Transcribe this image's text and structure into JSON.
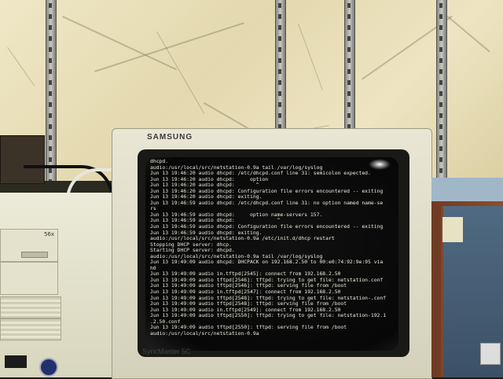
{
  "monitor": {
    "brand": "SAMSUNG",
    "model": "SyncMaster 5C"
  },
  "tower": {
    "drive_label": "56x"
  },
  "terminal": {
    "lines": [
      "dhcpd.",
      "audio:/usr/local/src/netstation-0.9a tail /var/log/syslog",
      "Jun 13 19:46:20 audio dhcpd: /etc/dhcpd.conf line 31: semicolon expected.",
      "Jun 13 19:46:20 audio dhcpd:     option",
      "Jun 13 19:46:20 audio dhcpd:       ^",
      "Jun 13 19:46:20 audio dhcpd: Configuration file errors encountered -- exiting",
      "Jun 13 19:46:20 audio dhcpd: exiting.",
      "Jun 13 19:46:59 audio dhcpd: /etc/dhcpd.conf line 31: no option named name-se",
      "rs",
      "Jun 13 19:46:59 audio dhcpd:     option name-servers 157.",
      "Jun 13 19:46:59 audio dhcpd:              ^",
      "Jun 13 19:46:59 audio dhcpd: Configuration file errors encountered -- exiting",
      "Jun 13 19:46:59 audio dhcpd: exiting.",
      "audio:/usr/local/src/netstation-0.9a /etc/init.d/dhcp restart",
      "Stopping DHCP server: dhcp.",
      "Starting DHCP server: dhcpd.",
      "audio:/usr/local/src/netstation-0.9a tail /var/log/syslog",
      "Jun 13 19:49:09 audio dhcpd: DHCPACK on 192.168.2.50 to 00:e0:74:92:9e:95 via",
      "h0",
      "Jun 13 19:49:09 audio in.tftpd[2545]: connect from 192.168.2.50",
      "Jun 13 19:49:09 audio tftpd[2546]: tftpd: trying to get file: netstation.conf",
      "Jun 13 19:49:09 audio tftpd[2546]: tftpd: serving file from /boot",
      "Jun 13 19:49:09 audio in.tftpd[2547]: connect from 192.168.2.50",
      "Jun 13 19:49:09 audio tftpd[2548]: tftpd: trying to get file: netstation-.conf",
      "Jun 13 19:49:09 audio tftpd[2548]: tftpd: serving file from /boot",
      "Jun 13 19:49:09 audio in.tftpd[2549]: connect from 192.168.2.50",
      "Jun 13 19:49:09 audio tftpd[2550]: tftpd: trying to get file: netstation-192.1",
      ".2.50.conf",
      "Jun 13 19:49:09 audio tftpd[2550]: tftpd: serving file from /boot",
      "audio:/usr/local/src/netstation-0.9a"
    ]
  },
  "colors": {
    "terminal_text": "#eeeede",
    "terminal_bg": "#0a0a0a",
    "monitor_bezel": "#e6e3d0",
    "wall_marble": "#e8dfb9",
    "cabinet_wood": "#7a4128",
    "power_button": "#23306e"
  },
  "icons": [
    "power-button-icon",
    "usb-port-icon"
  ]
}
